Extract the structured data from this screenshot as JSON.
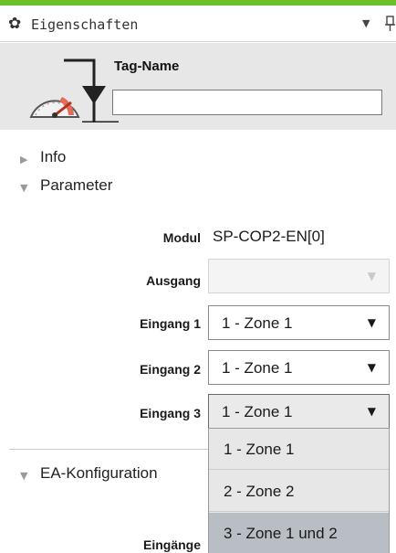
{
  "panel": {
    "title": "Eigenschaften",
    "title_icon": "gear-icon",
    "menu_icon": "chevron-down-icon",
    "pin_icon": "pin-icon",
    "accent_color": "#6cc02a"
  },
  "header": {
    "tag_name_label": "Tag-Name",
    "tag_name_value": "",
    "icon": "gauge-icon"
  },
  "sections": {
    "info": "Info",
    "parameter": "Parameter",
    "ea_konfiguration": "EA-Konfiguration"
  },
  "parameter": {
    "modul_label": "Modul",
    "modul_value": "SP-COP2-EN[0]",
    "ausgang_label": "Ausgang",
    "ausgang_value": "",
    "eingang1_label": "Eingang 1",
    "eingang1_value": "1 - Zone 1",
    "eingang2_label": "Eingang 2",
    "eingang2_value": "1 - Zone 1",
    "eingang3_label": "Eingang 3",
    "eingang3_value": "1 - Zone 1"
  },
  "ea": {
    "eingaenge_label": "Eingänge"
  },
  "dropdown_options": [
    {
      "label": "1 - Zone 1",
      "selected": false
    },
    {
      "label": "2 - Zone 2",
      "selected": false
    },
    {
      "label": "3 - Zone 1 und 2",
      "selected": true
    }
  ]
}
